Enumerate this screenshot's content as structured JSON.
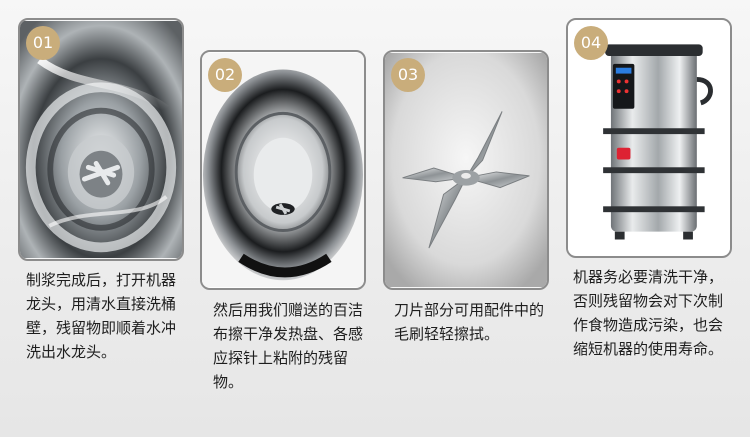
{
  "steps": [
    {
      "number": "01",
      "image": "blender-jar-interior-with-water",
      "caption": "制浆完成后，打开机器龙头，用清水直接洗桶壁，残留物即顺着水冲洗出水龙头。"
    },
    {
      "number": "02",
      "image": "stainless-steel-bowl-top-view",
      "caption": "然后用我们赠送的百洁布擦干净发热盘、各感应探针上粘附的残留物。"
    },
    {
      "number": "03",
      "image": "cross-blade-closeup",
      "caption": "刀片部分可用配件中的毛刷轻轻擦拭。"
    },
    {
      "number": "04",
      "image": "stainless-steel-soy-milk-machine",
      "caption": "机器务必要清洗干净，否则残留物会对下次制作食物造成污染，也会缩短机器的使用寿命。"
    }
  ],
  "colors": {
    "badge": "#c9ad7b",
    "frame": "#8c8c8c"
  }
}
